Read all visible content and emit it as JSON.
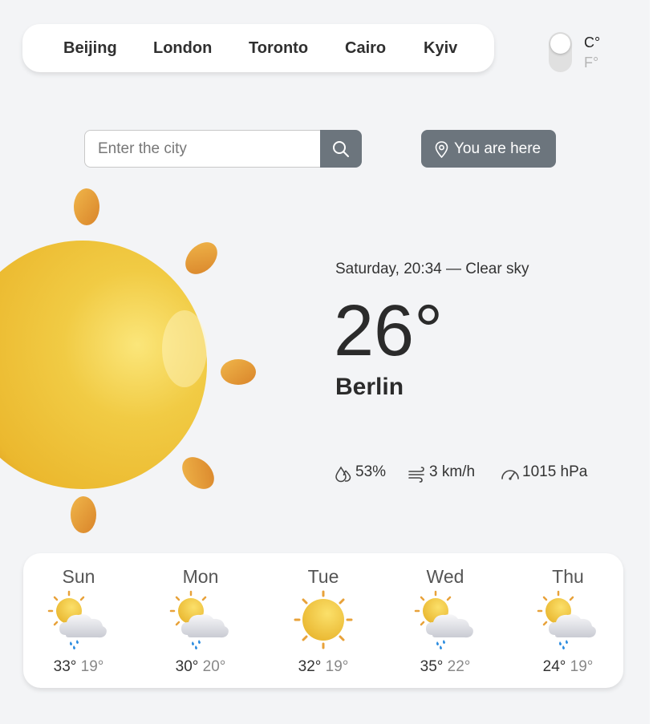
{
  "cities": [
    "Beijing",
    "London",
    "Toronto",
    "Cairo",
    "Kyiv"
  ],
  "units": {
    "celsius": "C°",
    "fahrenheit": "F°",
    "selected": "celsius"
  },
  "search": {
    "placeholder": "Enter the city",
    "icon": "search-icon"
  },
  "location_button": {
    "label": "You are here",
    "icon": "location-pin-icon"
  },
  "current": {
    "datetime": "Saturday, 20:34 — Clear sky",
    "temperature": "26°",
    "city": "Berlin",
    "icon": "sun-icon",
    "humidity": "53%",
    "wind": "3 km/h",
    "pressure": "1015 hPa"
  },
  "forecast": [
    {
      "day": "Sun",
      "max": "33°",
      "min": "19°",
      "icon": "sun-cloud-rain-icon"
    },
    {
      "day": "Mon",
      "max": "30°",
      "min": "20°",
      "icon": "sun-cloud-rain-icon"
    },
    {
      "day": "Tue",
      "max": "32°",
      "min": "19°",
      "icon": "sun-icon"
    },
    {
      "day": "Wed",
      "max": "35°",
      "min": "22°",
      "icon": "sun-cloud-rain-icon"
    },
    {
      "day": "Thu",
      "max": "24°",
      "min": "19°",
      "icon": "sun-cloud-rain-icon"
    }
  ],
  "colors": {
    "accent": "#6c757d",
    "sun": "#f0c23a",
    "ray": "#e39a2c",
    "background": "#f3f4f6"
  }
}
